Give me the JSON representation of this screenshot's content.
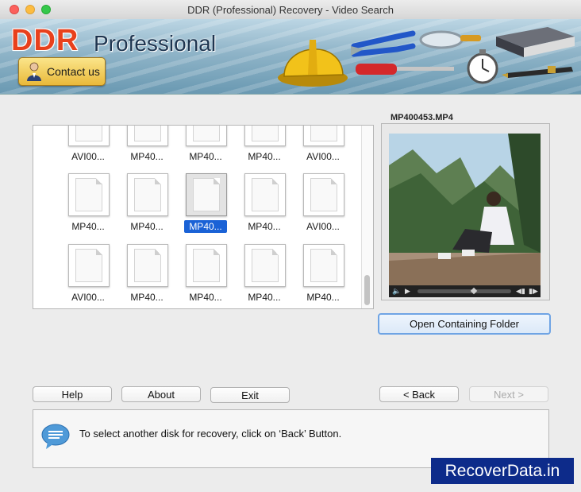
{
  "window": {
    "title": "DDR (Professional) Recovery - Video Search"
  },
  "banner": {
    "logo_ddr": "DDR",
    "logo_professional": "Professional",
    "contact_label": "Contact us"
  },
  "files": [
    {
      "name": "AVI00..."
    },
    {
      "name": "MP40..."
    },
    {
      "name": "MP40..."
    },
    {
      "name": "MP40..."
    },
    {
      "name": "AVI00..."
    },
    {
      "name": "MP40..."
    },
    {
      "name": "MP40..."
    },
    {
      "name": "MP40...",
      "selected": true
    },
    {
      "name": "MP40..."
    },
    {
      "name": "AVI00..."
    },
    {
      "name": "AVI00..."
    },
    {
      "name": "MP40..."
    },
    {
      "name": "MP40..."
    },
    {
      "name": "MP40..."
    },
    {
      "name": "MP40..."
    }
  ],
  "preview": {
    "filename": "MP400453.MP4",
    "open_folder_label": "Open Containing Folder"
  },
  "buttons": {
    "help": "Help",
    "about": "About",
    "exit": "Exit",
    "back": "< Back",
    "next": "Next >"
  },
  "info": {
    "message": "To select another disk for recovery, click on ‘Back’ Button."
  },
  "watermark": {
    "text": "RecoverData.in"
  },
  "colors": {
    "selection": "#1a62d6",
    "watermark_bg": "#0d2b8a",
    "logo_red": "#e8401c"
  }
}
